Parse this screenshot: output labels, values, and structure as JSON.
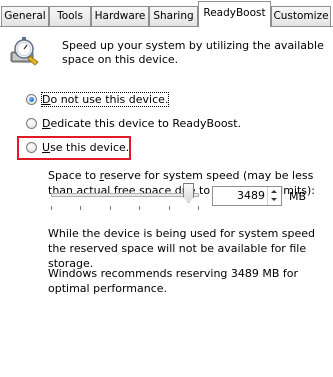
{
  "tabs": [
    {
      "label": "General"
    },
    {
      "label": "Tools"
    },
    {
      "label": "Hardware"
    },
    {
      "label": "Sharing"
    },
    {
      "label": "ReadyBoost"
    },
    {
      "label": "Customize"
    }
  ],
  "active_tab": "ReadyBoost",
  "intro_text": "Speed up your system by utilizing the available space on this device.",
  "options": [
    {
      "label_prefix": "",
      "label_mnemonic": "D",
      "label_rest": "o not use this device.",
      "selected": true
    },
    {
      "label_prefix": "",
      "label_mnemonic": "D",
      "label_rest": "edicate this device to ReadyBoost.",
      "selected": false
    },
    {
      "label_prefix": "",
      "label_mnemonic": "U",
      "label_rest": "se this device.",
      "selected": false
    }
  ],
  "reserve_label_a": "Space to ",
  "reserve_label_mnemonic": "r",
  "reserve_label_b": "eserve for system speed (may be less than actual free space due to file system limits):",
  "reserve_fraction": 0.93,
  "reserve_value": "3489",
  "unit": "MB",
  "note_in_use": "While the device is being used for system speed the reserved space will not be available for file storage.",
  "recommendation": "Windows recommends reserving 3489 MB for optimal performance.",
  "highlight_color": "#e01b24",
  "icon": "readyboost-stopwatch-icon"
}
